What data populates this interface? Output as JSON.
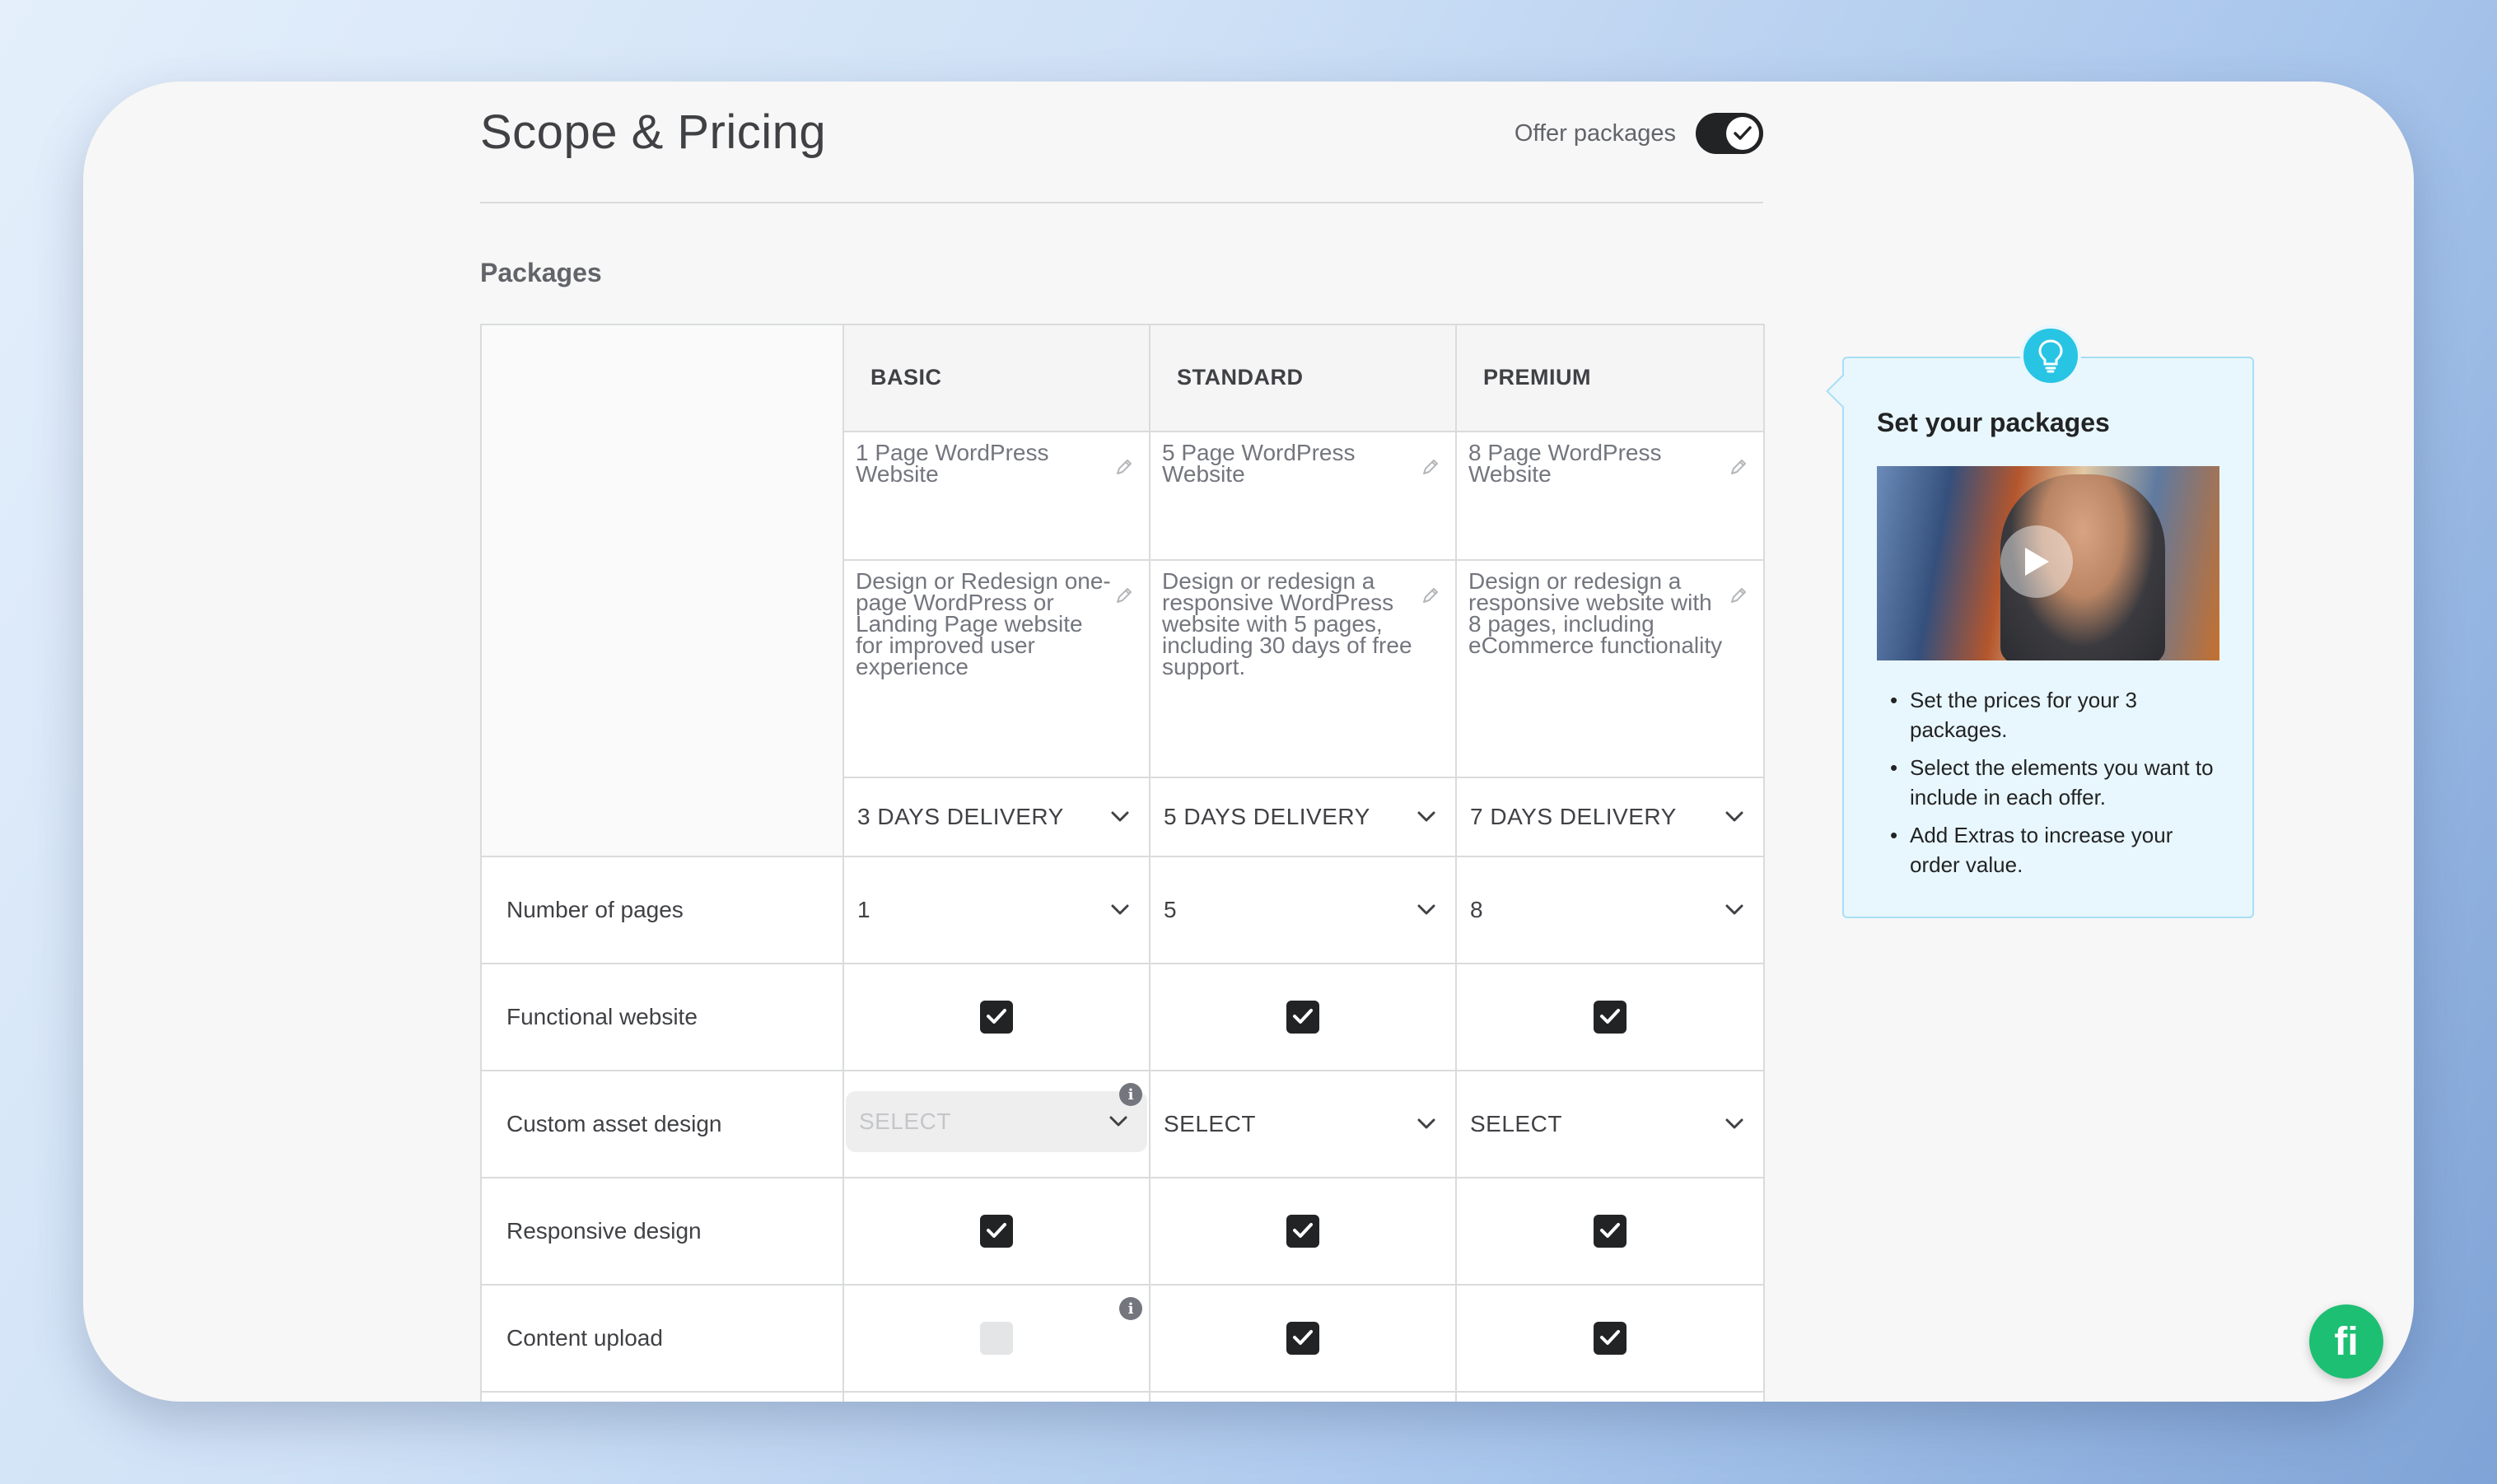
{
  "header": {
    "title": "Scope & Pricing",
    "offer_packages_label": "Offer packages",
    "offer_packages_on": true
  },
  "section_title": "Packages",
  "packages": [
    {
      "tier": "BASIC",
      "name": "1 Page WordPress Website",
      "description": "Design or Redesign one-page WordPress or Landing Page website for improved user experience",
      "delivery": "3 DAYS DELIVERY",
      "pages": "1",
      "custom_asset": "SELECT"
    },
    {
      "tier": "STANDARD",
      "name": "5 Page WordPress Website",
      "description": "Design or redesign a responsive WordPress website with 5 pages, including 30 days of free support.",
      "delivery": "5 DAYS DELIVERY",
      "pages": "5",
      "custom_asset": "SELECT"
    },
    {
      "tier": "PREMIUM",
      "name": "8 Page WordPress Website",
      "description": "Design or redesign a responsive website with 8 pages, including eCommerce functionality",
      "delivery": "7 DAYS DELIVERY",
      "pages": "8",
      "custom_asset": "SELECT"
    }
  ],
  "rows": {
    "number_of_pages": "Number of pages",
    "functional_website": "Functional website",
    "custom_asset_design": "Custom asset design",
    "responsive_design": "Responsive design",
    "content_upload": "Content upload"
  },
  "checks": {
    "functional_website": [
      true,
      true,
      true
    ],
    "responsive_design": [
      true,
      true,
      true
    ],
    "content_upload": [
      false,
      true,
      true
    ]
  },
  "tip": {
    "title": "Set your packages",
    "items": [
      "Set the prices for your 3 packages.",
      "Select the elements you want to include in each offer.",
      "Add Extras to increase your order value."
    ]
  },
  "fab_letter": "fi",
  "colors": {
    "accent_green": "#1dbf73",
    "tip_blue": "#28c4e4",
    "checkbox_dark": "#222325"
  }
}
